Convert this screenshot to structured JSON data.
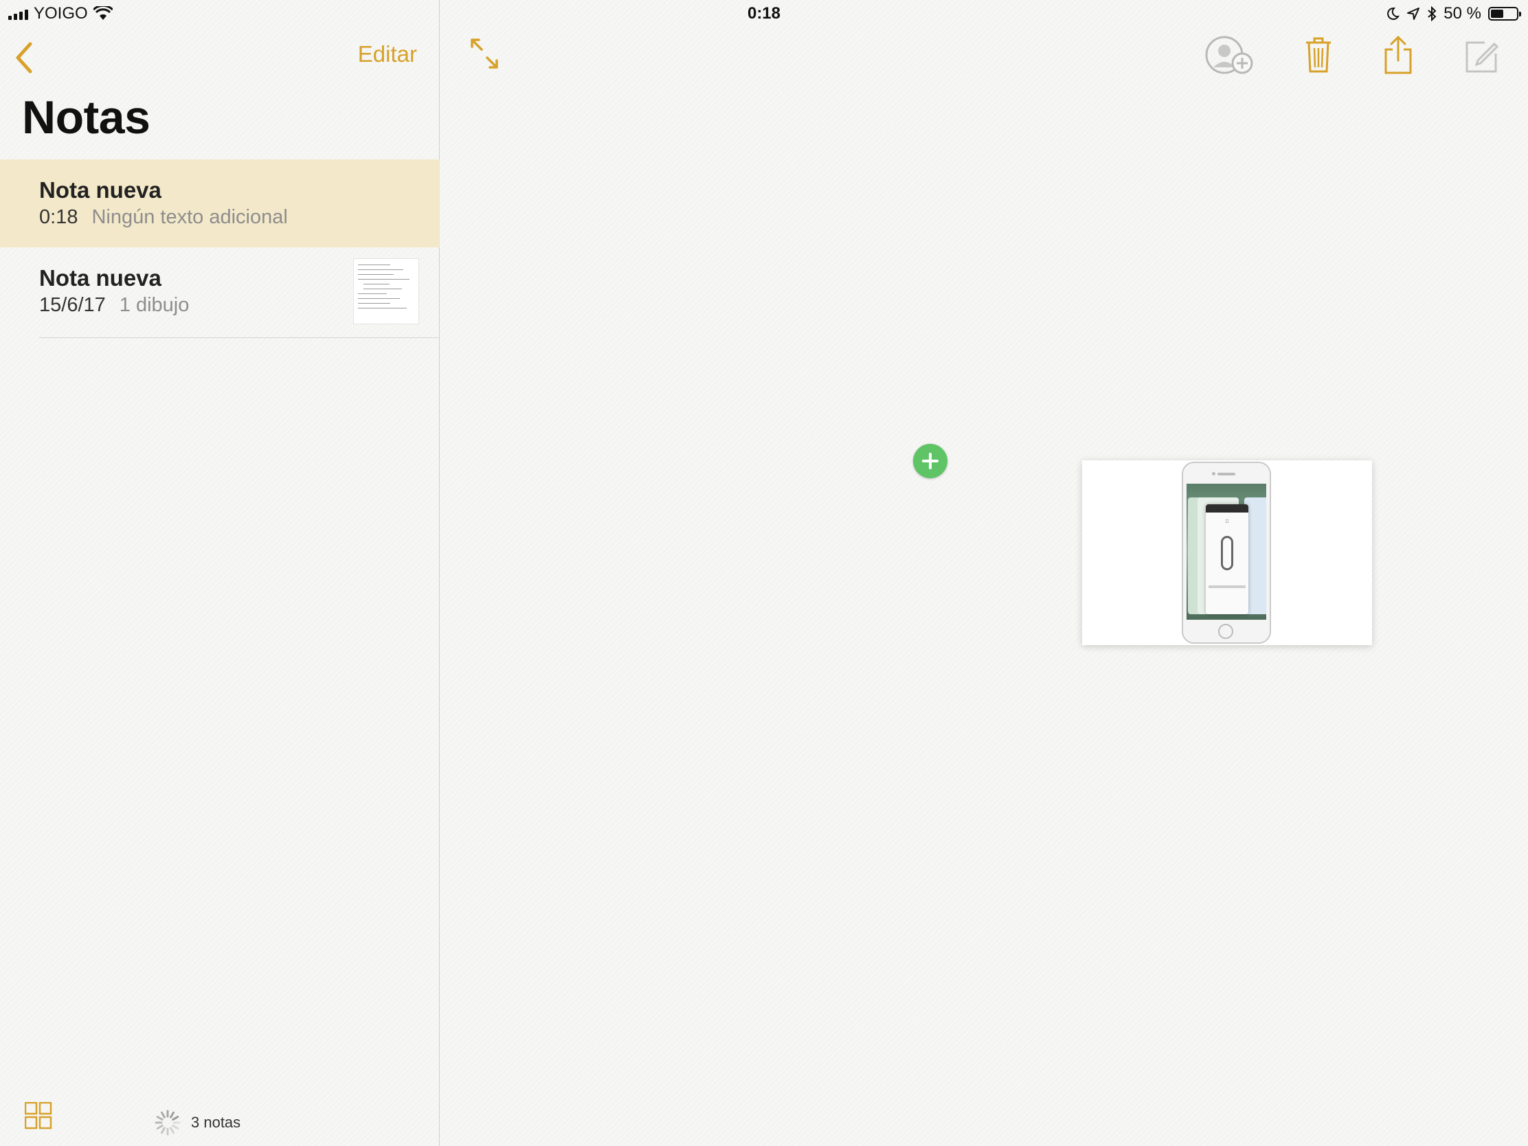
{
  "status_bar": {
    "carrier": "YOIGO",
    "time": "0:18",
    "battery_percent": "50 %",
    "battery_level": 0.5
  },
  "sidebar": {
    "edit_label": "Editar",
    "title": "Notas",
    "notes": [
      {
        "title": "Nota nueva",
        "date": "0:18",
        "preview": "Ningún texto adicional",
        "selected": true
      },
      {
        "title": "Nota nueva",
        "date": "15/6/17",
        "preview": "1 dibujo",
        "selected": false
      }
    ],
    "note_count": "3 notas"
  },
  "colors": {
    "accent": "#d7a12a",
    "selected_row": "#f3e8c9",
    "add_badge": "#5ec466"
  },
  "icons": {
    "back": "chevron-left-icon",
    "expand": "expand-icon",
    "add_people": "add-people-icon",
    "trash": "trash-icon",
    "share": "share-icon",
    "compose": "compose-icon",
    "grid": "grid-icon",
    "spinner": "spinner-icon",
    "add_badge": "plus-icon"
  }
}
